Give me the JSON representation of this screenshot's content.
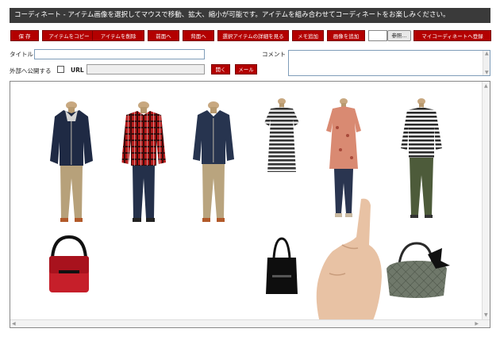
{
  "header": {
    "title": "コーディネート - アイテム画像を選択してマウスで移動、拡大、縮小が可能です。アイテムを組み合わせてコーディネートをお楽しみください。"
  },
  "toolbar": {
    "save": "保 存",
    "copy_item": "アイテムをコピー",
    "delete_item": "アイテムを削除",
    "bring_front": "前面へ",
    "send_back": "背面へ",
    "view_details": "選択アイテムの詳細を見る",
    "add_memo": "メモ追加",
    "add_image": "画像を追加",
    "browse": "参照...",
    "register": "マイコーディネートへ登録"
  },
  "form": {
    "title_label": "タイトル",
    "comment_label": "コメント",
    "publish_label": "外部へ公開する",
    "url_label": "URL",
    "open_button": "開く",
    "mail_button": "メール"
  },
  "colors": {
    "accent": "#b30000",
    "header_bg": "#3a3a3a"
  },
  "canvas_items": [
    {
      "name": "navy-hooded-jacket-outfit"
    },
    {
      "name": "red-plaid-shirt-outfit"
    },
    {
      "name": "navy-jacket-khaki-outfit"
    },
    {
      "name": "striped-dress"
    },
    {
      "name": "floral-tunic-outfit"
    },
    {
      "name": "striped-sweater-outfit"
    },
    {
      "name": "red-messenger-bag"
    },
    {
      "name": "black-tote-bag"
    },
    {
      "name": "quilted-bow-bag"
    },
    {
      "name": "pointing-hand"
    }
  ]
}
